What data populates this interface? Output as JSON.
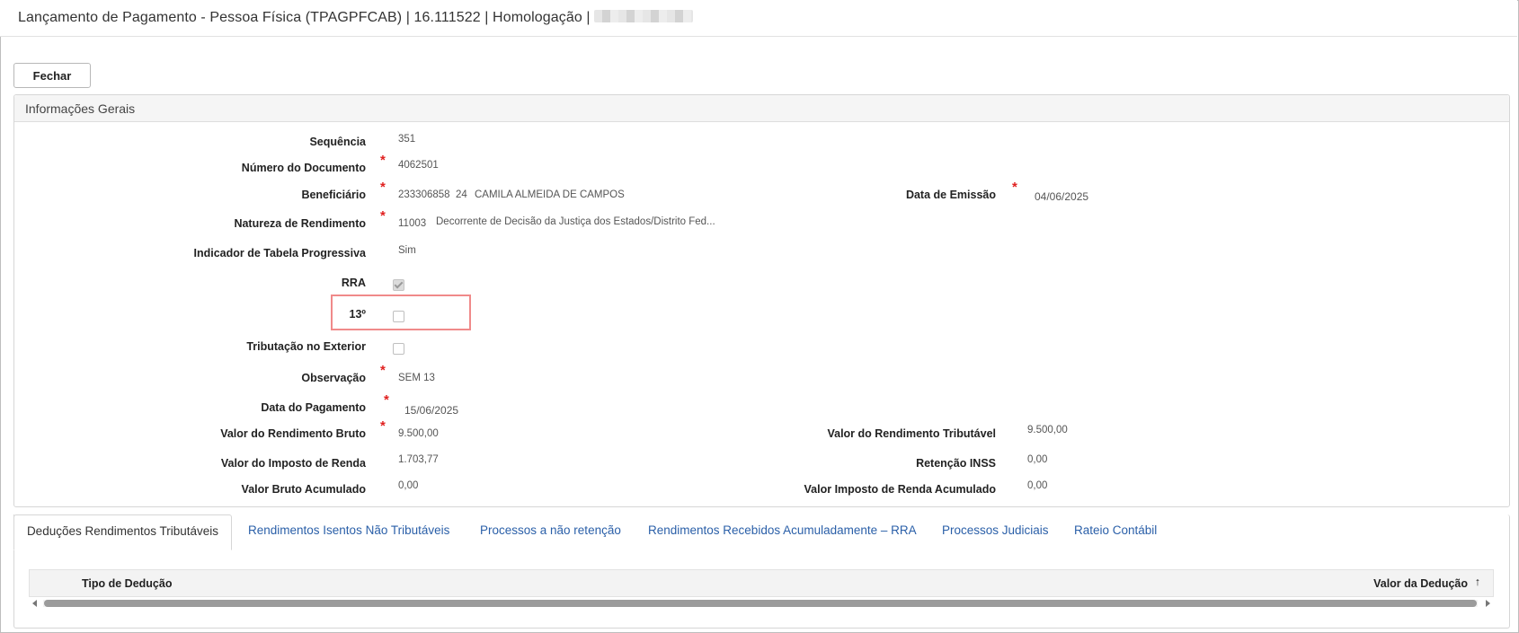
{
  "window": {
    "title": "Lançamento de Pagamento - Pessoa Física (TPAGPFCAB) | 16.111522 | Homologação |"
  },
  "toolbar": {
    "close_label": "Fechar"
  },
  "panel": {
    "title": "Informações Gerais",
    "fields": {
      "sequencia": {
        "label": "Sequência",
        "value": "351"
      },
      "numero_documento": {
        "label": "Número do Documento",
        "value": "4062501"
      },
      "beneficiario": {
        "label": "Beneficiário",
        "code": "233306858",
        "sub": "24",
        "name": "CAMILA ALMEIDA DE CAMPOS"
      },
      "data_emissao": {
        "label": "Data de Emissão",
        "value": "04/06/2025"
      },
      "natureza": {
        "label": "Natureza de Rendimento",
        "code": "11003",
        "description": "Decorrente de Decisão da Justiça dos Estados/Distrito Fed..."
      },
      "indicador_tabela": {
        "label": "Indicador de Tabela Progressiva",
        "value": "Sim"
      },
      "rra": {
        "label": "RRA",
        "checked": true
      },
      "decimo_terceiro": {
        "label": "13º",
        "checked": false
      },
      "tributacao_exterior": {
        "label": "Tributação no Exterior",
        "checked": false
      },
      "observacao": {
        "label": "Observação",
        "value": "SEM 13"
      },
      "data_pagamento": {
        "label": "Data do Pagamento",
        "value": "15/06/2025"
      },
      "valor_rendimento_bruto": {
        "label": "Valor do Rendimento Bruto",
        "value": "9.500,00"
      },
      "valor_rendimento_tributavel": {
        "label": "Valor do Rendimento Tributável",
        "value": "9.500,00"
      },
      "valor_imposto_renda": {
        "label": "Valor do Imposto de Renda",
        "value": "1.703,77"
      },
      "retencao_inss": {
        "label": "Retenção INSS",
        "value": "0,00"
      },
      "valor_bruto_acumulado": {
        "label": "Valor Bruto Acumulado",
        "value": "0,00"
      },
      "valor_ir_acumulado": {
        "label": "Valor Imposto de Renda Acumulado",
        "value": "0,00"
      }
    }
  },
  "tabs": [
    {
      "label": "Deduções Rendimentos Tributáveis",
      "active": true
    },
    {
      "label": "Rendimentos Isentos Não Tributáveis",
      "active": false
    },
    {
      "label": "Processos a não retenção",
      "active": false
    },
    {
      "label": "Rendimentos Recebidos Acumuladamente – RRA",
      "active": false
    },
    {
      "label": "Processos Judiciais",
      "active": false
    },
    {
      "label": "Rateio Contábil",
      "active": false
    }
  ],
  "grid": {
    "columns": [
      {
        "label": "Tipo de Dedução"
      },
      {
        "label": "Valor da Dedução",
        "sort_indicator": "↑"
      }
    ]
  },
  "colors": {
    "required": "#e0201f",
    "link": "#2a5fa8",
    "highlight": "#f08a8a"
  }
}
